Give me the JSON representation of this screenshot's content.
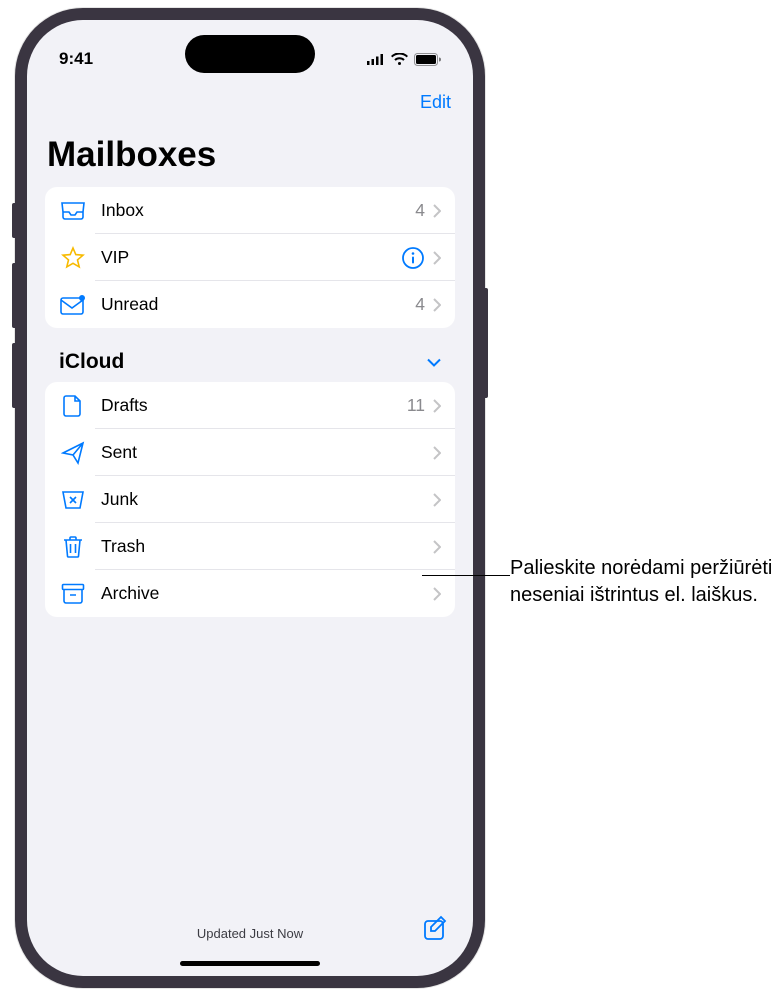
{
  "status_bar": {
    "time": "9:41"
  },
  "nav": {
    "edit": "Edit"
  },
  "page": {
    "title": "Mailboxes"
  },
  "smart_mailboxes": [
    {
      "icon": "inbox",
      "label": "Inbox",
      "count": "4"
    },
    {
      "icon": "star",
      "label": "VIP",
      "info": true
    },
    {
      "icon": "unread",
      "label": "Unread",
      "count": "4"
    }
  ],
  "account": {
    "name": "iCloud",
    "mailboxes": [
      {
        "icon": "drafts",
        "label": "Drafts",
        "count": "11"
      },
      {
        "icon": "sent",
        "label": "Sent"
      },
      {
        "icon": "junk",
        "label": "Junk"
      },
      {
        "icon": "trash",
        "label": "Trash"
      },
      {
        "icon": "archive",
        "label": "Archive"
      }
    ]
  },
  "bottom": {
    "status": "Updated Just Now"
  },
  "callout": {
    "text": "Palieskite norėdami peržiūrėti neseniai ištrintus el. laiškus."
  }
}
